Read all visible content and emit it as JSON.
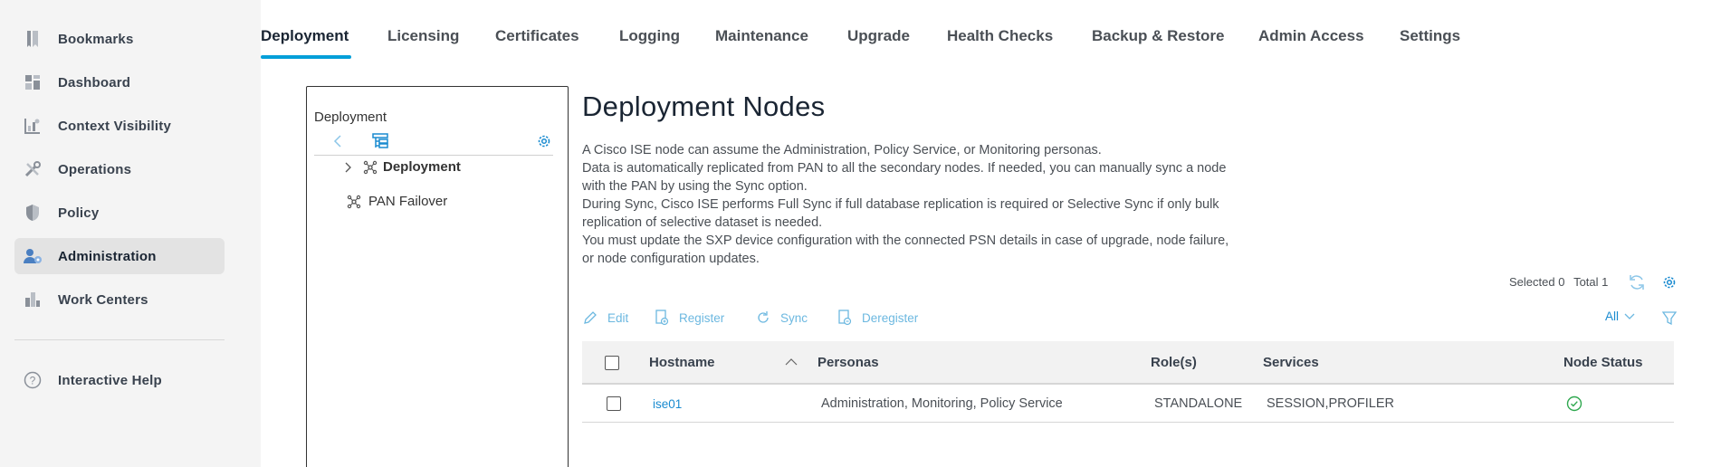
{
  "sidebar": {
    "items": [
      {
        "label": "Bookmarks",
        "icon": "bookmark-icon"
      },
      {
        "label": "Dashboard",
        "icon": "dashboard-icon"
      },
      {
        "label": "Context Visibility",
        "icon": "context-visibility-icon"
      },
      {
        "label": "Operations",
        "icon": "operations-icon"
      },
      {
        "label": "Policy",
        "icon": "policy-shield-icon"
      },
      {
        "label": "Administration",
        "icon": "administration-icon"
      },
      {
        "label": "Work Centers",
        "icon": "work-centers-icon"
      }
    ],
    "help": {
      "label": "Interactive Help",
      "icon": "help-icon"
    },
    "active": "Administration"
  },
  "tabs": [
    {
      "label": "Deployment"
    },
    {
      "label": "Licensing"
    },
    {
      "label": "Certificates"
    },
    {
      "label": "Logging"
    },
    {
      "label": "Maintenance"
    },
    {
      "label": "Upgrade"
    },
    {
      "label": "Health Checks"
    },
    {
      "label": "Backup & Restore"
    },
    {
      "label": "Admin Access"
    },
    {
      "label": "Settings"
    }
  ],
  "active_tab": "Deployment",
  "tree": {
    "title": "Deployment",
    "nodes": [
      {
        "label": "Deployment"
      },
      {
        "label": "PAN Failover"
      }
    ]
  },
  "main": {
    "title": "Deployment Nodes",
    "description": [
      "A Cisco ISE node can assume the Administration, Policy Service, or Monitoring personas.",
      "Data is automatically replicated from PAN to all the secondary nodes. If needed, you can manually sync a node",
      "with the PAN by using the Sync option.",
      "During Sync, Cisco ISE performs Full Sync if full database replication is required or Selective Sync if only bulk",
      "replication of selective dataset is needed.",
      "You must update the SXP device configuration with the connected PSN details in case of upgrade, node failure,",
      "or node configuration updates."
    ],
    "selected_label": "Selected",
    "selected_count": "0",
    "total_label": "Total",
    "total_count": "1",
    "actions": {
      "edit": "Edit",
      "register": "Register",
      "sync": "Sync",
      "deregister": "Deregister"
    },
    "filter_select": "All"
  },
  "table": {
    "columns": [
      "Hostname",
      "Personas",
      "Role(s)",
      "Services",
      "Node Status"
    ],
    "rows": [
      {
        "hostname": "ise01",
        "personas": "Administration, Monitoring, Policy Service",
        "role": "STANDALONE",
        "services": "SESSION,PROFILER",
        "status": "ok"
      }
    ]
  },
  "colors": {
    "accent": "#049fd9",
    "link": "#1a8bd0",
    "success": "#2fa84f",
    "action": "#6cb8e0"
  }
}
